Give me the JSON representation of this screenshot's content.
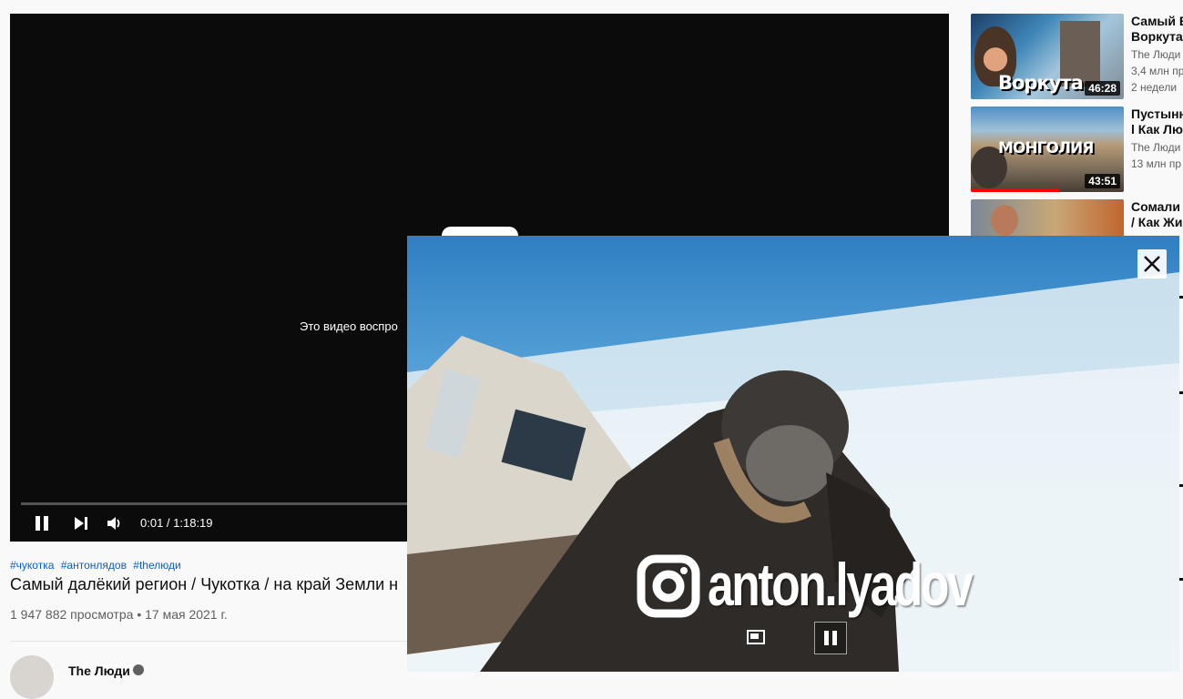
{
  "player": {
    "message": "Это видео воспро",
    "time": "0:01 / 1:18:19",
    "progress_fraction": 0.0
  },
  "video": {
    "hashtags": [
      "#чукотка",
      "#антонлядов",
      "#thелюди"
    ],
    "title": "Самый далёкий регион / Чукотка / на край Земли н",
    "views": "1 947 882 просмотра",
    "date": "17 мая 2021 г.",
    "meta_separator": "•",
    "channel": "The Люди"
  },
  "sidebar": {
    "items": [
      {
        "title_lines": [
          "Самый В",
          "Воркута"
        ],
        "channel": "The Люди",
        "views": "3,4 млн пр",
        "age": "2 недели",
        "duration": "46:28",
        "thumb_text": "Воркута"
      },
      {
        "title_lines": [
          "Пустынн",
          "l Как Лю"
        ],
        "channel": "The Люди",
        "views": "13 млн пр",
        "age": "",
        "duration": "43:51",
        "thumb_text": "МОНГОЛИЯ",
        "watched_fraction": 0.58
      },
      {
        "title_lines": [
          "Сомали",
          "/ Как Жи"
        ],
        "channel": "",
        "views": "",
        "age": "",
        "duration": "",
        "thumb_text": ""
      }
    ]
  },
  "mini_player": {
    "instagram_handle": "anton.lyadov"
  },
  "icons": {
    "play_pause": "pause-icon",
    "next": "next-icon",
    "volume": "volume-icon",
    "close": "close-icon",
    "expand": "expand-icon",
    "mini_pause": "pause-icon",
    "instagram": "instagram-icon"
  },
  "colors": {
    "accent": "#ff0000",
    "link": "#065fd4"
  }
}
